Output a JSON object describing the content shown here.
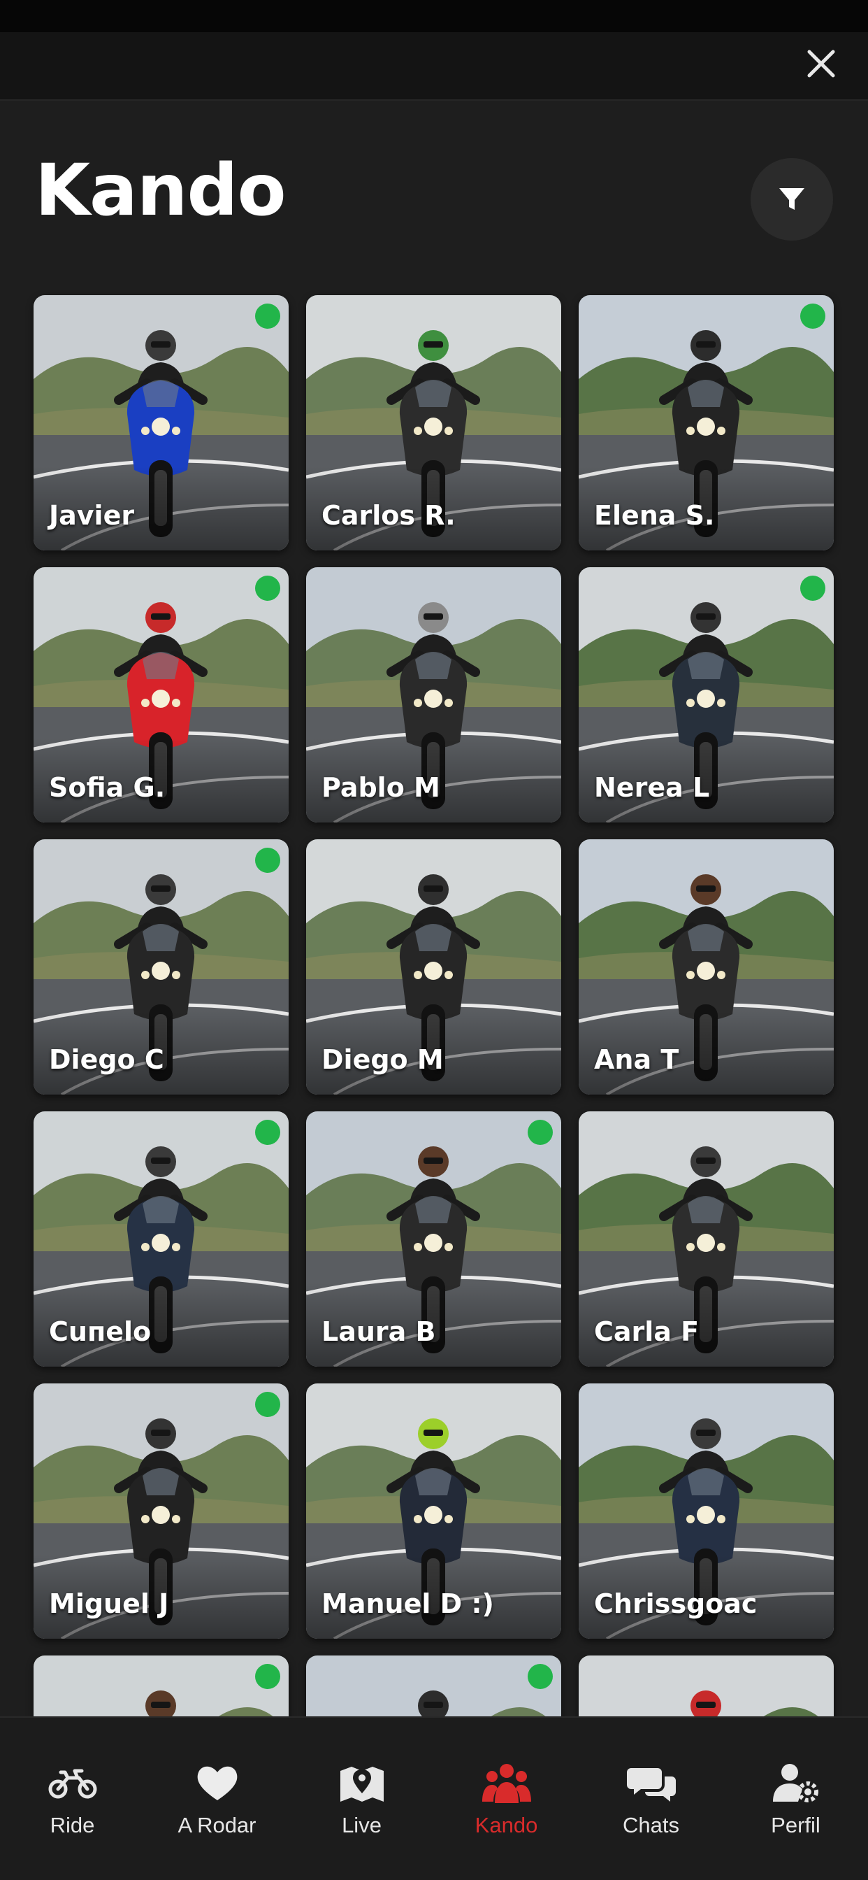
{
  "header": {
    "title": "Kando"
  },
  "icons": {
    "close": "close-icon",
    "filter": "filter-icon"
  },
  "colors": {
    "accent": "#d92b2b",
    "online": "#22b54a",
    "background": "#1e1e1e"
  },
  "riders": [
    {
      "name": "Javier",
      "online": true,
      "bike": "#1a3fc2",
      "helmet": "#3a3a3a"
    },
    {
      "name": "Carlos R.",
      "online": false,
      "bike": "#2c2c2c",
      "helmet": "#3f8f3f"
    },
    {
      "name": "Elena S.",
      "online": true,
      "bike": "#242424",
      "helmet": "#2c2c2c"
    },
    {
      "name": "Sofia G.",
      "online": true,
      "bike": "#d8232a",
      "helmet": "#c72a2a"
    },
    {
      "name": "Pablo M",
      "online": false,
      "bike": "#2a2a2a",
      "helmet": "#8a8a8a"
    },
    {
      "name": "Nerea L",
      "online": true,
      "bike": "#27303c",
      "helmet": "#333333"
    },
    {
      "name": "Diego C",
      "online": true,
      "bike": "#262626",
      "helmet": "#3a3a3a"
    },
    {
      "name": "Diego M",
      "online": false,
      "bike": "#262626",
      "helmet": "#2f2f2f"
    },
    {
      "name": "Ana T",
      "online": false,
      "bike": "#2b2b2b",
      "helmet": "#5a3a28"
    },
    {
      "name": "Cuпelo",
      "online": true,
      "bike": "#263245",
      "helmet": "#3a3a3a"
    },
    {
      "name": "Laura B",
      "online": true,
      "bike": "#2a2a2a",
      "helmet": "#5a3a28"
    },
    {
      "name": "Carla F",
      "online": false,
      "bike": "#2d2d2d",
      "helmet": "#3a3a3a"
    },
    {
      "name": "Miguel J",
      "online": true,
      "bike": "#222222",
      "helmet": "#333333"
    },
    {
      "name": "Manuel D :)",
      "online": false,
      "bike": "#232a38",
      "helmet": "#9ccf2a"
    },
    {
      "name": "Chrissgoac",
      "online": false,
      "bike": "#253044",
      "helmet": "#3a3a3a"
    },
    {
      "name": "",
      "online": true,
      "bike": "#2a2a2a",
      "helmet": "#5a3a28"
    },
    {
      "name": "",
      "online": true,
      "bike": "#2a2a2a",
      "helmet": "#2c2c2c"
    },
    {
      "name": "",
      "online": false,
      "bike": "#2a2a2a",
      "helmet": "#c72a2a"
    }
  ],
  "tabs": [
    {
      "label": "Ride",
      "icon": "motorcycle-icon",
      "active": false
    },
    {
      "label": "A Rodar",
      "icon": "heart-icon",
      "active": false
    },
    {
      "label": "Live",
      "icon": "map-pin-icon",
      "active": false
    },
    {
      "label": "Kando",
      "icon": "group-icon",
      "active": true
    },
    {
      "label": "Chats",
      "icon": "chat-bubbles-icon",
      "active": false
    },
    {
      "label": "Perfil",
      "icon": "user-gear-icon",
      "active": false
    }
  ]
}
